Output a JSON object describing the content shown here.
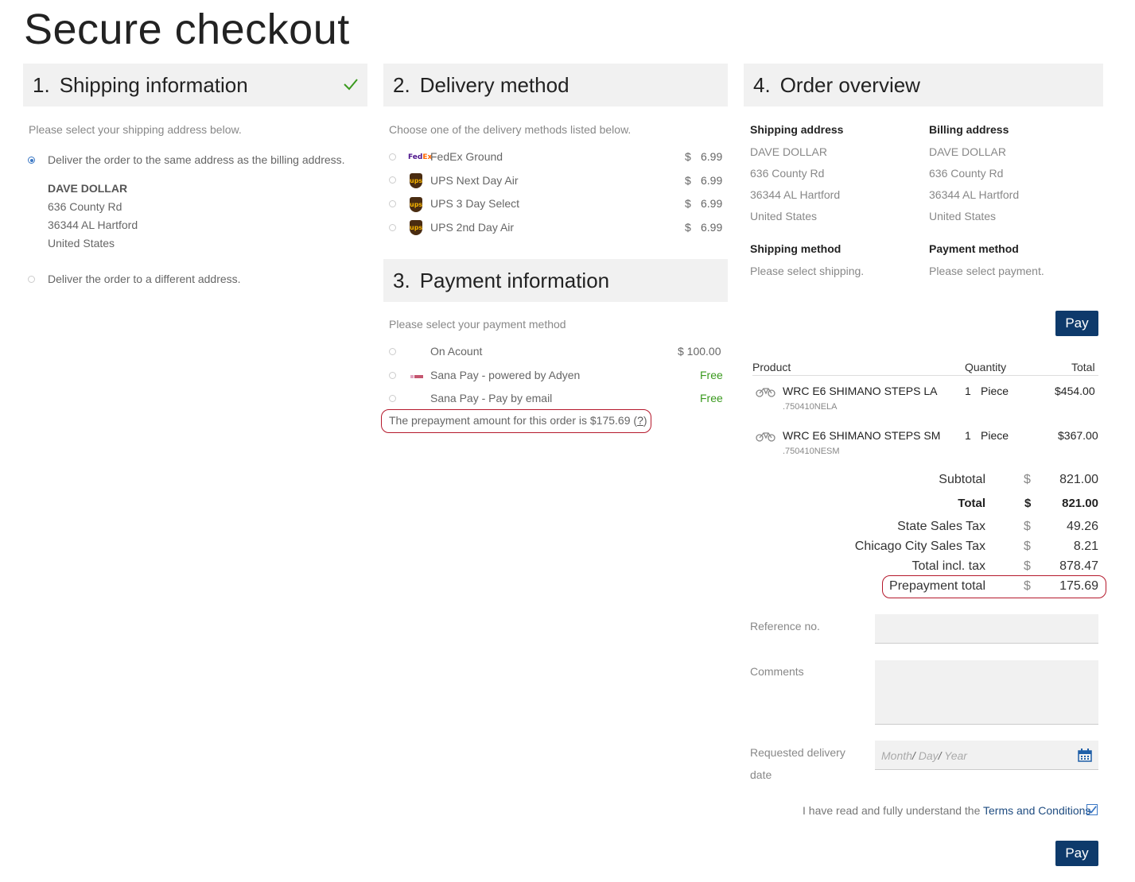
{
  "page": {
    "title": "Secure checkout"
  },
  "shipping": {
    "num": "1.",
    "title": "Shipping information",
    "intro": "Please select your shipping address below.",
    "option_same": "Deliver the order to the same address as the billing address.",
    "address": {
      "name": "DAVE DOLLAR",
      "street": "636 County Rd",
      "city": "36344 AL Hartford",
      "country": "United States"
    },
    "option_different": "Deliver the order to a different address."
  },
  "delivery": {
    "num": "2.",
    "title": "Delivery method",
    "intro": "Choose one of the delivery methods listed below.",
    "methods": [
      {
        "label": "FedEx Ground",
        "currency": "$",
        "price": "6.99",
        "icon": "fedex-icon"
      },
      {
        "label": "UPS Next Day Air",
        "currency": "$",
        "price": "6.99",
        "icon": "ups-icon"
      },
      {
        "label": "UPS 3 Day Select",
        "currency": "$",
        "price": "6.99",
        "icon": "ups-icon"
      },
      {
        "label": "UPS 2nd Day Air",
        "currency": "$",
        "price": "6.99",
        "icon": "ups-icon"
      }
    ]
  },
  "payment": {
    "num": "3.",
    "title": "Payment information",
    "intro": "Please select your payment method",
    "methods": [
      {
        "label": "On Acount",
        "price": "$ 100.00"
      },
      {
        "label": "Sana Pay - powered by Adyen",
        "price": "Free"
      },
      {
        "label": "Sana Pay - Pay by email",
        "price": "Free"
      }
    ],
    "prepay_note": "The prepayment amount for this order is $175.69 (",
    "prepay_help": "?",
    "prepay_close": ")"
  },
  "overview": {
    "num": "4.",
    "title": "Order overview",
    "shipping_address_label": "Shipping address",
    "billing_address_label": "Billing address",
    "shipping_address": {
      "name": "DAVE DOLLAR",
      "street": "636 County Rd",
      "city": "36344 AL Hartford",
      "country": "United States"
    },
    "billing_address": {
      "name": "DAVE DOLLAR",
      "street": "636 County Rd",
      "city": "36344 AL Hartford",
      "country": "United States"
    },
    "shipping_method_label": "Shipping method",
    "shipping_method_value": "Please select shipping.",
    "payment_method_label": "Payment method",
    "payment_method_value": "Please select payment.",
    "pay_label": "Pay",
    "table": {
      "headers": {
        "product": "Product",
        "quantity": "Quantity",
        "total": "Total"
      },
      "rows": [
        {
          "name": "WRC E6 SHIMANO STEPS LA",
          "sku": ".750410NELA",
          "qty": "1",
          "unit": "Piece",
          "total": "$454.00"
        },
        {
          "name": "WRC E6 SHIMANO STEPS SM",
          "sku": ".750410NESM",
          "qty": "1",
          "unit": "Piece",
          "total": "$367.00"
        }
      ]
    },
    "totals": [
      {
        "label": "Subtotal",
        "cur": "$",
        "value": "821.00"
      },
      {
        "label": "Total",
        "cur": "$",
        "value": "821.00"
      },
      {
        "label": "State Sales Tax",
        "cur": "$",
        "value": "49.26"
      },
      {
        "label": "Chicago City Sales Tax",
        "cur": "$",
        "value": "8.21"
      },
      {
        "label": "Total incl. tax",
        "cur": "$",
        "value": "878.47"
      },
      {
        "label": "Prepayment total",
        "cur": "$",
        "value": "175.69"
      }
    ],
    "reference_label": "Reference no.",
    "reference_value": "",
    "comments_label": "Comments",
    "comments_value": "",
    "delivery_date_label_1": "Requested delivery",
    "delivery_date_label_2": "date",
    "date_placeholder": {
      "month": "Month",
      "sep1": "/",
      "day": "Day",
      "sep2": "/",
      "year": "Year"
    },
    "terms_text": "I have read and fully understand the ",
    "terms_link": "Terms and Conditions",
    "terms_checked": true
  },
  "colors": {
    "primary": "#0e3a6b",
    "highlight": "#b5192c",
    "free": "#3a9a1e",
    "check": "#3a9a1e"
  }
}
